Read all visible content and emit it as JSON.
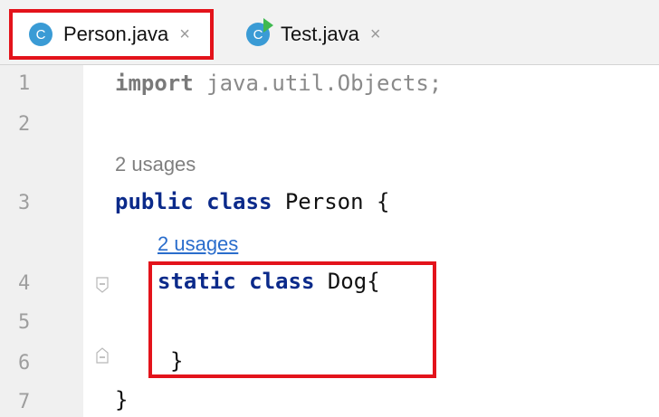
{
  "tabs": [
    {
      "label": "Person.java",
      "icon": "class-icon",
      "icon_letter": "C",
      "active": true,
      "close": "×"
    },
    {
      "label": "Test.java",
      "icon": "runnable-class-icon",
      "icon_letter": "C",
      "active": false,
      "close": "×"
    }
  ],
  "line_numbers": [
    "1",
    "2",
    "3",
    "4",
    "5",
    "6",
    "7"
  ],
  "code": {
    "line1": {
      "keyword": "import",
      "rest": " java.util.Objects;"
    },
    "usages_hint_1": "2 usages",
    "line3": {
      "kw1": "public",
      "kw2": "class",
      "rest": " Person {"
    },
    "usages_hint_2": "2 usages",
    "line4": {
      "kw1": "static",
      "kw2": "class",
      "rest": " Dog{"
    },
    "line6": {
      "rest": "}"
    },
    "line7": {
      "rest": "}"
    }
  },
  "colors": {
    "highlight": "#e3131b",
    "keyword": "#0b2a8a",
    "link": "#2a6dcc",
    "class_icon": "#3a9bd5",
    "run_badge": "#3fb950"
  }
}
